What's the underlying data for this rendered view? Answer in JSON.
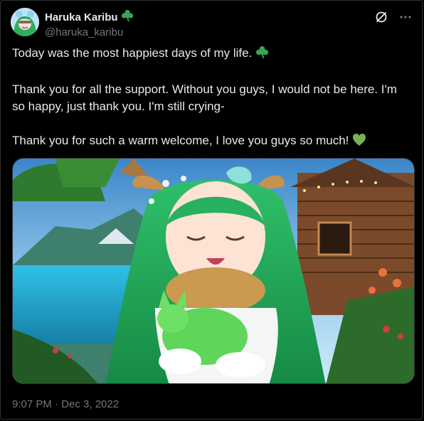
{
  "author": {
    "display_name": "Haruka Karibu",
    "handle": "@haruka_karibu"
  },
  "header": {
    "grok_icon": "slash-circle-icon",
    "more_icon": "more-dots-icon"
  },
  "tweet": {
    "paragraphs": [
      "Today was the most happiest days of my life.",
      "Thank you for all the support. Without you guys, I would not be here. I'm so happy, just thank you. I'm still crying-",
      "Thank you for such a warm welcome, I love you guys so much!"
    ],
    "media_description": "image"
  },
  "meta": {
    "timestamp": "9:07 PM · Dec 3, 2022"
  },
  "colors": {
    "background": "#000000",
    "text": "#e7e9ea",
    "muted": "#71767b",
    "border": "#2f3336",
    "clover": "#3aa655",
    "heart": "#78b159"
  }
}
